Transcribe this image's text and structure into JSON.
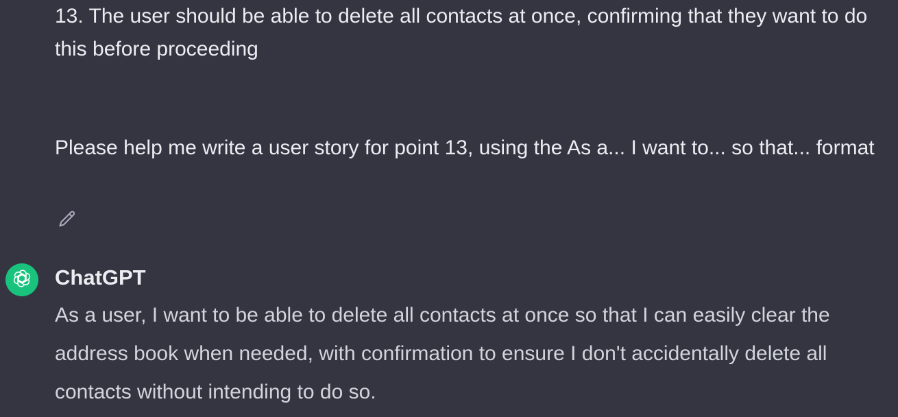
{
  "user_message": {
    "paragraph_1": "13. The user should be able to delete all contacts at once, confirming that they want to do this before proceeding",
    "paragraph_2": "Please help me write a user story for point 13, using the As a... I want to... so that... format",
    "edit_icon": "pencil-icon"
  },
  "assistant": {
    "name": "ChatGPT",
    "avatar_icon": "openai-logo-icon",
    "avatar_color": "#19c37d",
    "message": "As a user, I want to be able to delete all contacts at once so that I can easily clear the address book when needed, with confirmation to ensure I don't accidentally delete all contacts without intending to do so."
  },
  "colors": {
    "background": "#343541",
    "text": "#ececf1",
    "assistant_text": "#d1d5db",
    "icon": "#acacbe"
  }
}
